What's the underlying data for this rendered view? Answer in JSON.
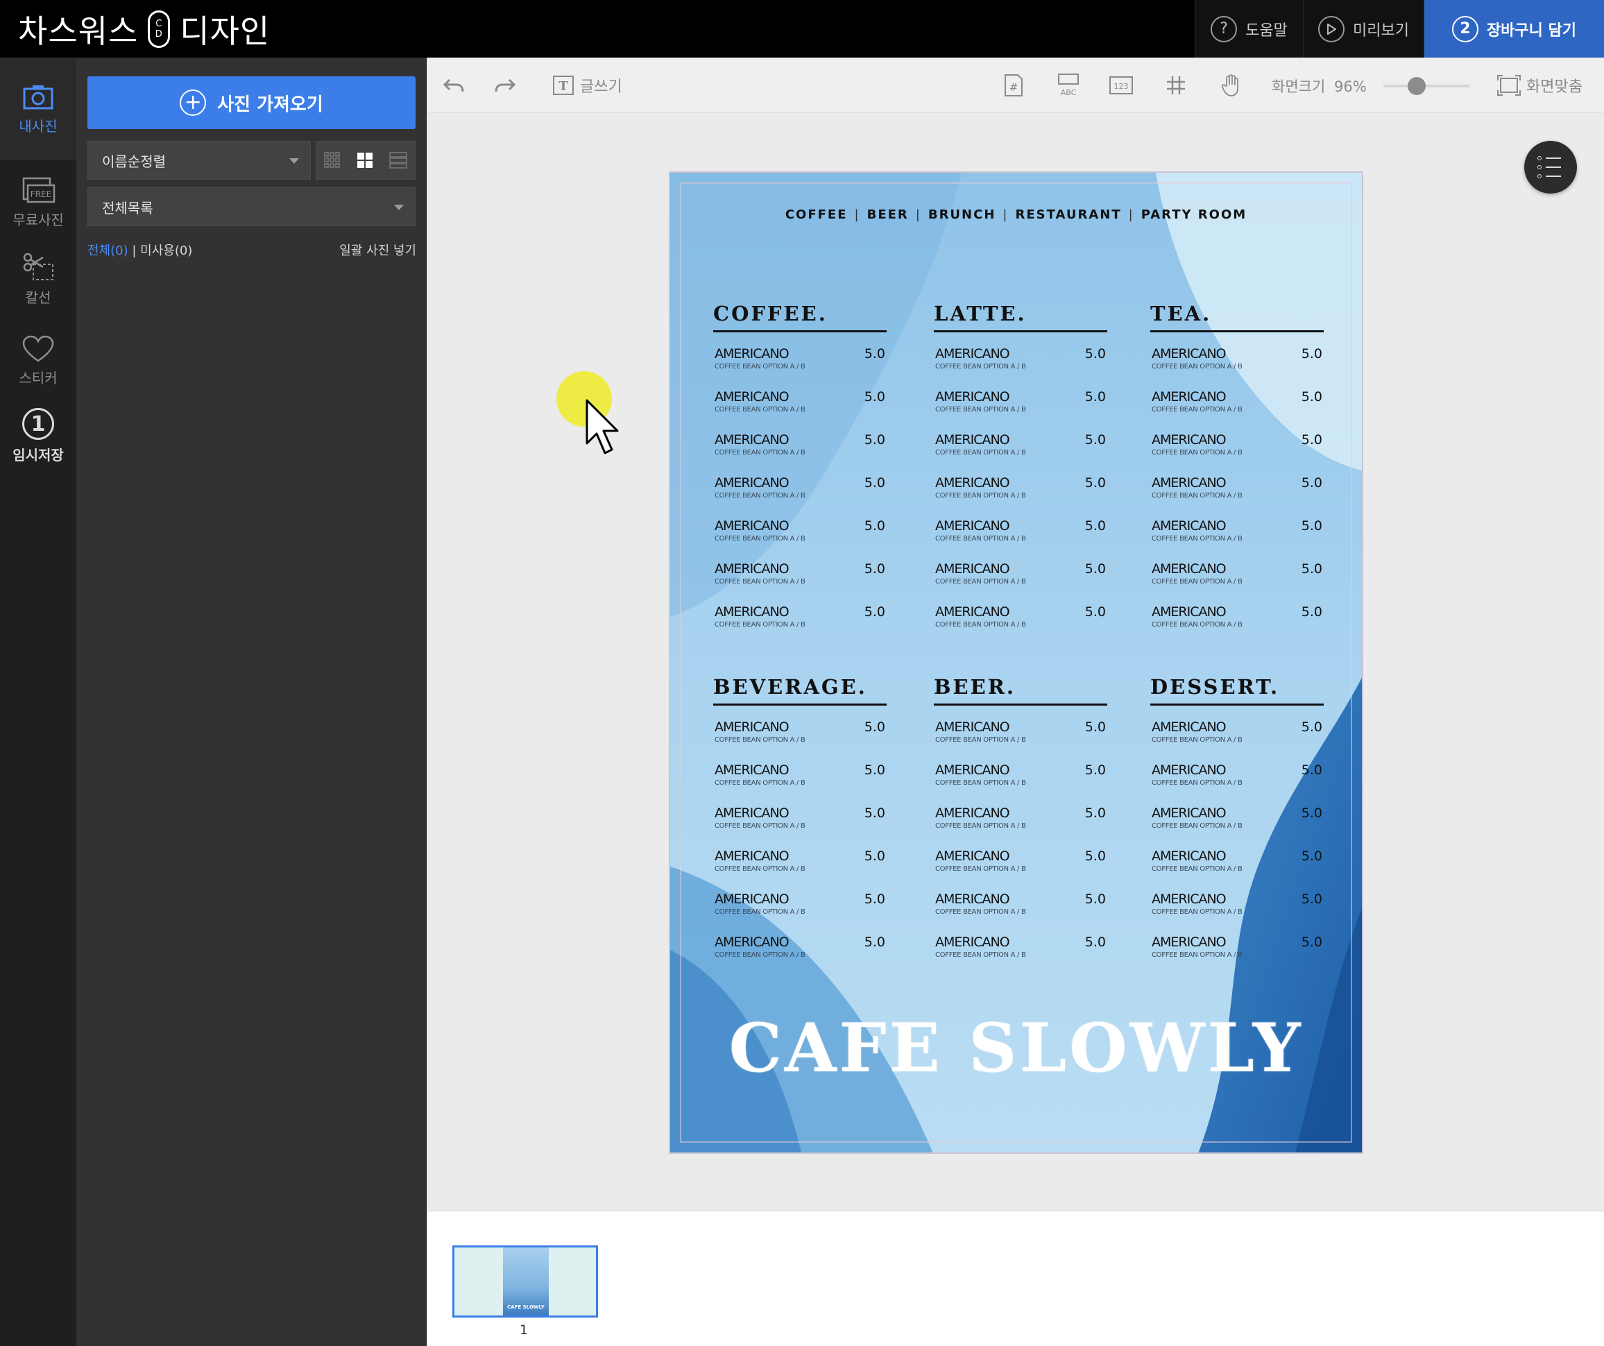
{
  "header": {
    "logo_left": "차스워스",
    "logo_pill": "C·D",
    "logo_right": "디자인",
    "help_label": "도움말",
    "preview_label": "미리보기",
    "cart_step": "2",
    "cart_label": "장바구니 담기",
    "accent": "#2f66c3"
  },
  "nav": {
    "items": [
      {
        "label": "내사진",
        "icon": "camera-icon"
      },
      {
        "label": "무료사진",
        "icon": "free-photo-icon"
      },
      {
        "label": "칼선",
        "icon": "scissors-icon"
      },
      {
        "label": "스티커",
        "icon": "heart-icon"
      },
      {
        "label": "임시저장",
        "icon": "save-number-icon",
        "badge": "1"
      }
    ]
  },
  "panel": {
    "import_label": "사진 가져오기",
    "sort_value": "이름순정렬",
    "folder_value": "전체목록",
    "count_all": "전체(0)",
    "count_sep": " | ",
    "count_unused": "미사용(0)",
    "bulk_insert": "일괄 사진 넣기"
  },
  "toolbar": {
    "write_text": "글쓰기",
    "zoom_label": "화면크기",
    "zoom_value": "96%",
    "zoom_fraction": 0.35,
    "fit_label": "화면맞춤",
    "abc": "ABC",
    "num": "123"
  },
  "menu": {
    "topnav": [
      "COFFEE",
      "BEER",
      "BRUNCH",
      "RESTAURANT",
      "PARTY ROOM"
    ],
    "topnav_sep": "|",
    "sections": [
      {
        "title": "COFFEE.",
        "items": [
          "AMERICANO",
          "AMERICANO",
          "AMERICANO",
          "AMERICANO",
          "AMERICANO",
          "AMERICANO",
          "AMERICANO"
        ]
      },
      {
        "title": "LATTE.",
        "items": [
          "AMERICANO",
          "AMERICANO",
          "AMERICANO",
          "AMERICANO",
          "AMERICANO",
          "AMERICANO",
          "AMERICANO"
        ]
      },
      {
        "title": "TEA.",
        "items": [
          "AMERICANO",
          "AMERICANO",
          "AMERICANO",
          "AMERICANO",
          "AMERICANO",
          "AMERICANO",
          "AMERICANO"
        ]
      },
      {
        "title": "BEVERAGE.",
        "items": [
          "AMERICANO",
          "AMERICANO",
          "AMERICANO",
          "AMERICANO",
          "AMERICANO",
          "AMERICANO"
        ]
      },
      {
        "title": "BEER.",
        "items": [
          "AMERICANO",
          "AMERICANO",
          "AMERICANO",
          "AMERICANO",
          "AMERICANO",
          "AMERICANO"
        ]
      },
      {
        "title": "DESSERT.",
        "items": [
          "AMERICANO",
          "AMERICANO",
          "AMERICANO",
          "AMERICANO",
          "AMERICANO",
          "AMERICANO"
        ]
      }
    ],
    "price": "5.0",
    "item_sub": "COFFEE BEAN OPTION A / B",
    "cafe_name": "CAFE SLOWLY"
  },
  "pages": {
    "thumb_caption": "CAFE SLOWLY",
    "page_number": "1"
  }
}
